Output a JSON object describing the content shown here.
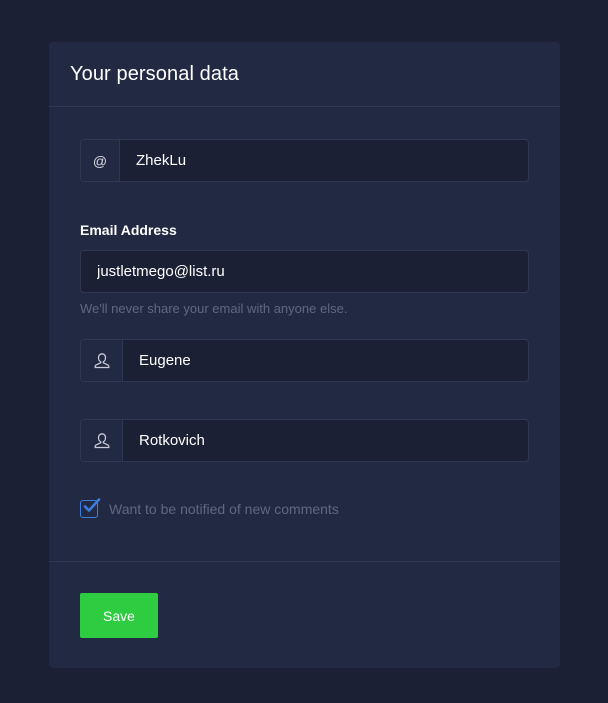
{
  "card": {
    "title": "Your personal data"
  },
  "username": {
    "addon_text": "@",
    "value": "ZhekLu"
  },
  "email": {
    "label": "Email Address",
    "value": "justletmego@list.ru",
    "help_text": "We'll never share your email with anyone else."
  },
  "first_name": {
    "icon": "user-icon",
    "value": "Eugene"
  },
  "last_name": {
    "icon": "user-icon",
    "value": "Rotkovich"
  },
  "notify": {
    "checked": true,
    "label": "Want to be notified of new comments"
  },
  "actions": {
    "save_label": "Save"
  },
  "colors": {
    "page_background": "#1b2034",
    "card_background": "#222a43",
    "save_button": "#2ecc40",
    "checkbox_accent": "#3b7ddd"
  }
}
